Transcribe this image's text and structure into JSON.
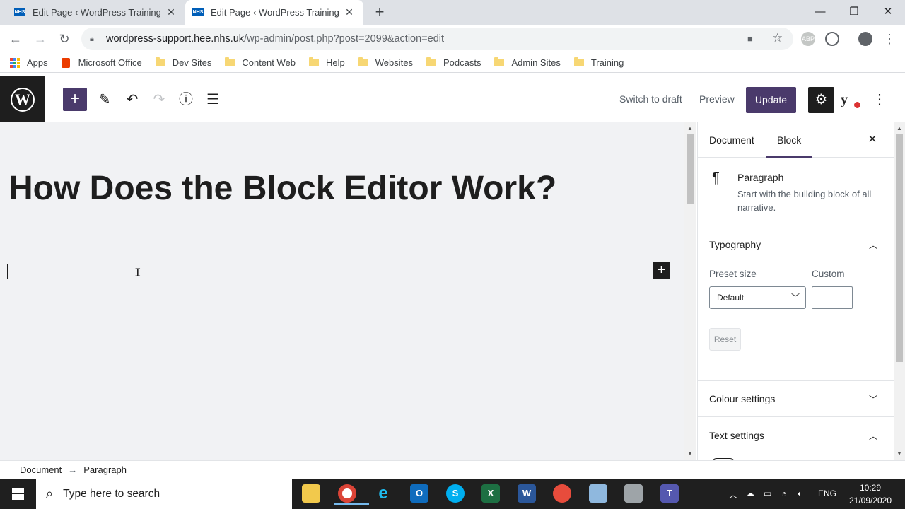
{
  "browser": {
    "tabs": [
      {
        "favicon": "NHS",
        "title": "Edit Page ‹ WordPress Training &"
      },
      {
        "favicon": "NHS",
        "title": "Edit Page ‹ WordPress Training &"
      }
    ],
    "url_host": "wordpress-support.hee.nhs.uk",
    "url_path": "/wp-admin/post.php?post=2099&action=edit",
    "extension_abp": "ABP",
    "bookmarks": [
      {
        "label": "Apps",
        "icon": "apps-grid-icon"
      },
      {
        "label": "Microsoft Office",
        "icon": "office-icon"
      },
      {
        "label": "Dev Sites",
        "icon": "folder-icon"
      },
      {
        "label": "Content Web",
        "icon": "folder-icon"
      },
      {
        "label": "Help",
        "icon": "folder-icon"
      },
      {
        "label": "Websites",
        "icon": "folder-icon"
      },
      {
        "label": "Podcasts",
        "icon": "folder-icon"
      },
      {
        "label": "Admin Sites",
        "icon": "folder-icon"
      },
      {
        "label": "Training",
        "icon": "folder-icon"
      }
    ]
  },
  "wp_toolbar": {
    "logo": "W",
    "switch_to_draft": "Switch to draft",
    "preview": "Preview",
    "update": "Update",
    "yoast": "y"
  },
  "editor": {
    "post_title": "How Does the Block Editor Work?"
  },
  "sidebar": {
    "tabs": [
      "Document",
      "Block"
    ],
    "active_tab": "Block",
    "block": {
      "name": "Paragraph",
      "description": "Start with the building block of all narrative."
    },
    "typography": {
      "heading": "Typography",
      "preset_label": "Preset size",
      "custom_label": "Custom",
      "preset_value": "Default",
      "custom_value": "",
      "reset": "Reset"
    },
    "colour_settings": "Colour settings",
    "text_settings": "Text settings"
  },
  "breadcrumb": [
    "Document",
    "Paragraph"
  ],
  "taskbar": {
    "search_placeholder": "Type here to search",
    "language": "ENG",
    "time": "10:29",
    "date": "21/09/2020"
  },
  "colors": {
    "wp_accent": "#4a3a6b",
    "wp_dark": "#1e1e1e",
    "canvas_bg": "#f1f2f4",
    "taskbar_bg": "#1f1f1f"
  }
}
